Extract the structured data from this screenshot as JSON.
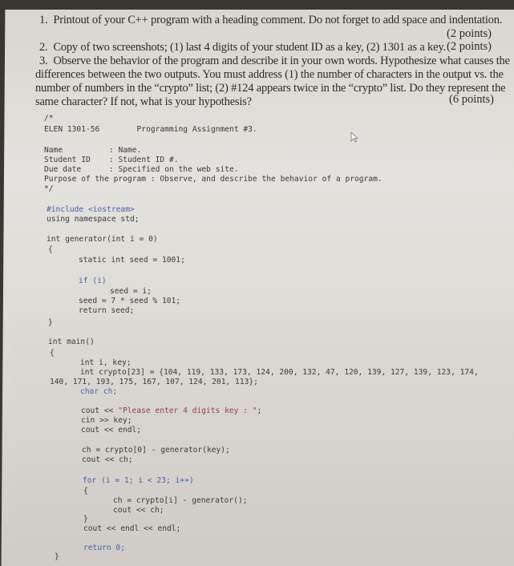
{
  "questions": [
    {
      "number": "1.",
      "text": "Printout of your C++ program with a heading comment. Do not forget to add space and indentation.",
      "points": "(2 points)"
    },
    {
      "number": "2.",
      "text": "Copy of two screenshots; (1) last 4 digits of your student ID as a key, (2) 1301 as a key.",
      "points": "(2 points)"
    },
    {
      "number": "3.",
      "lines": [
        "Observe the behavior of the program and describe it in your own words. Hypothesize what causes the",
        "differences between the two outputs. You must address (1) the number of characters in the output vs. the",
        "number of numbers in the “crypto” list; (2) #124 appears twice in the “crypto” list. Do they represent the",
        "same character? If not, what is your hypothesis?"
      ],
      "points": "(6 points)"
    }
  ],
  "code": {
    "comment_open": "/*",
    "course": "ELEN 1301-56",
    "assignment": "Programming Assignment #3.",
    "header_fields": [
      {
        "label": "Name",
        "sep": ":",
        "value": "Name."
      },
      {
        "label": "Student ID",
        "sep": ":",
        "value": "Student ID #."
      },
      {
        "label": "Due date",
        "sep": ":",
        "value": "Specified on the web site."
      }
    ],
    "purpose_label": "Purpose of the program",
    "purpose_value": ": Observe, and describe the behavior of a program.",
    "comment_close": "*/",
    "include": "#include <iostream>",
    "using": "using namespace std;",
    "gen_sig": "int generator(int i = 0)",
    "open_brace": "{",
    "close_brace": "}",
    "static_seed": "static int seed = 1001;",
    "if_line": "if (i)",
    "seed_assign": "seed = i;",
    "seed_calc": "seed = 7 * seed % 101;",
    "return_seed": "return seed;",
    "main_sig": "int main()",
    "decl_ik": "int i, key;",
    "crypto_decl": "int crypto[23] = {104, 119, 133, 173, 124, 200, 132, 47, 120, 139, 127, 139, 123, 174,",
    "crypto_cont": "140, 171, 193, 175, 167, 107, 124, 201, 113};",
    "crypto_values": [
      104,
      119,
      133,
      173,
      124,
      200,
      132,
      47,
      120,
      139,
      127,
      139,
      123,
      174,
      140,
      171,
      193,
      175,
      167,
      107,
      124,
      201,
      113
    ],
    "char_decl": "char ch;",
    "cout_prompt_pre": "cout << ",
    "cout_prompt_str": "\"Please enter 4 digits key : \"",
    "cout_prompt_end": ";",
    "cin_key": "cin >> key;",
    "cout_endl": "cout << endl;",
    "ch_first": "ch = crypto[0] - generator(key);",
    "cout_ch": "cout << ch;",
    "for_line": "for (i = 1; i < 23; i++)",
    "ch_loop": "ch = crypto[i] - generator();",
    "cout_ch2": "cout << ch;",
    "cout_endl2": "cout << endl << endl;",
    "return_zero": "return 0;"
  },
  "icons": {
    "cursor": "mouse-pointer-icon"
  }
}
